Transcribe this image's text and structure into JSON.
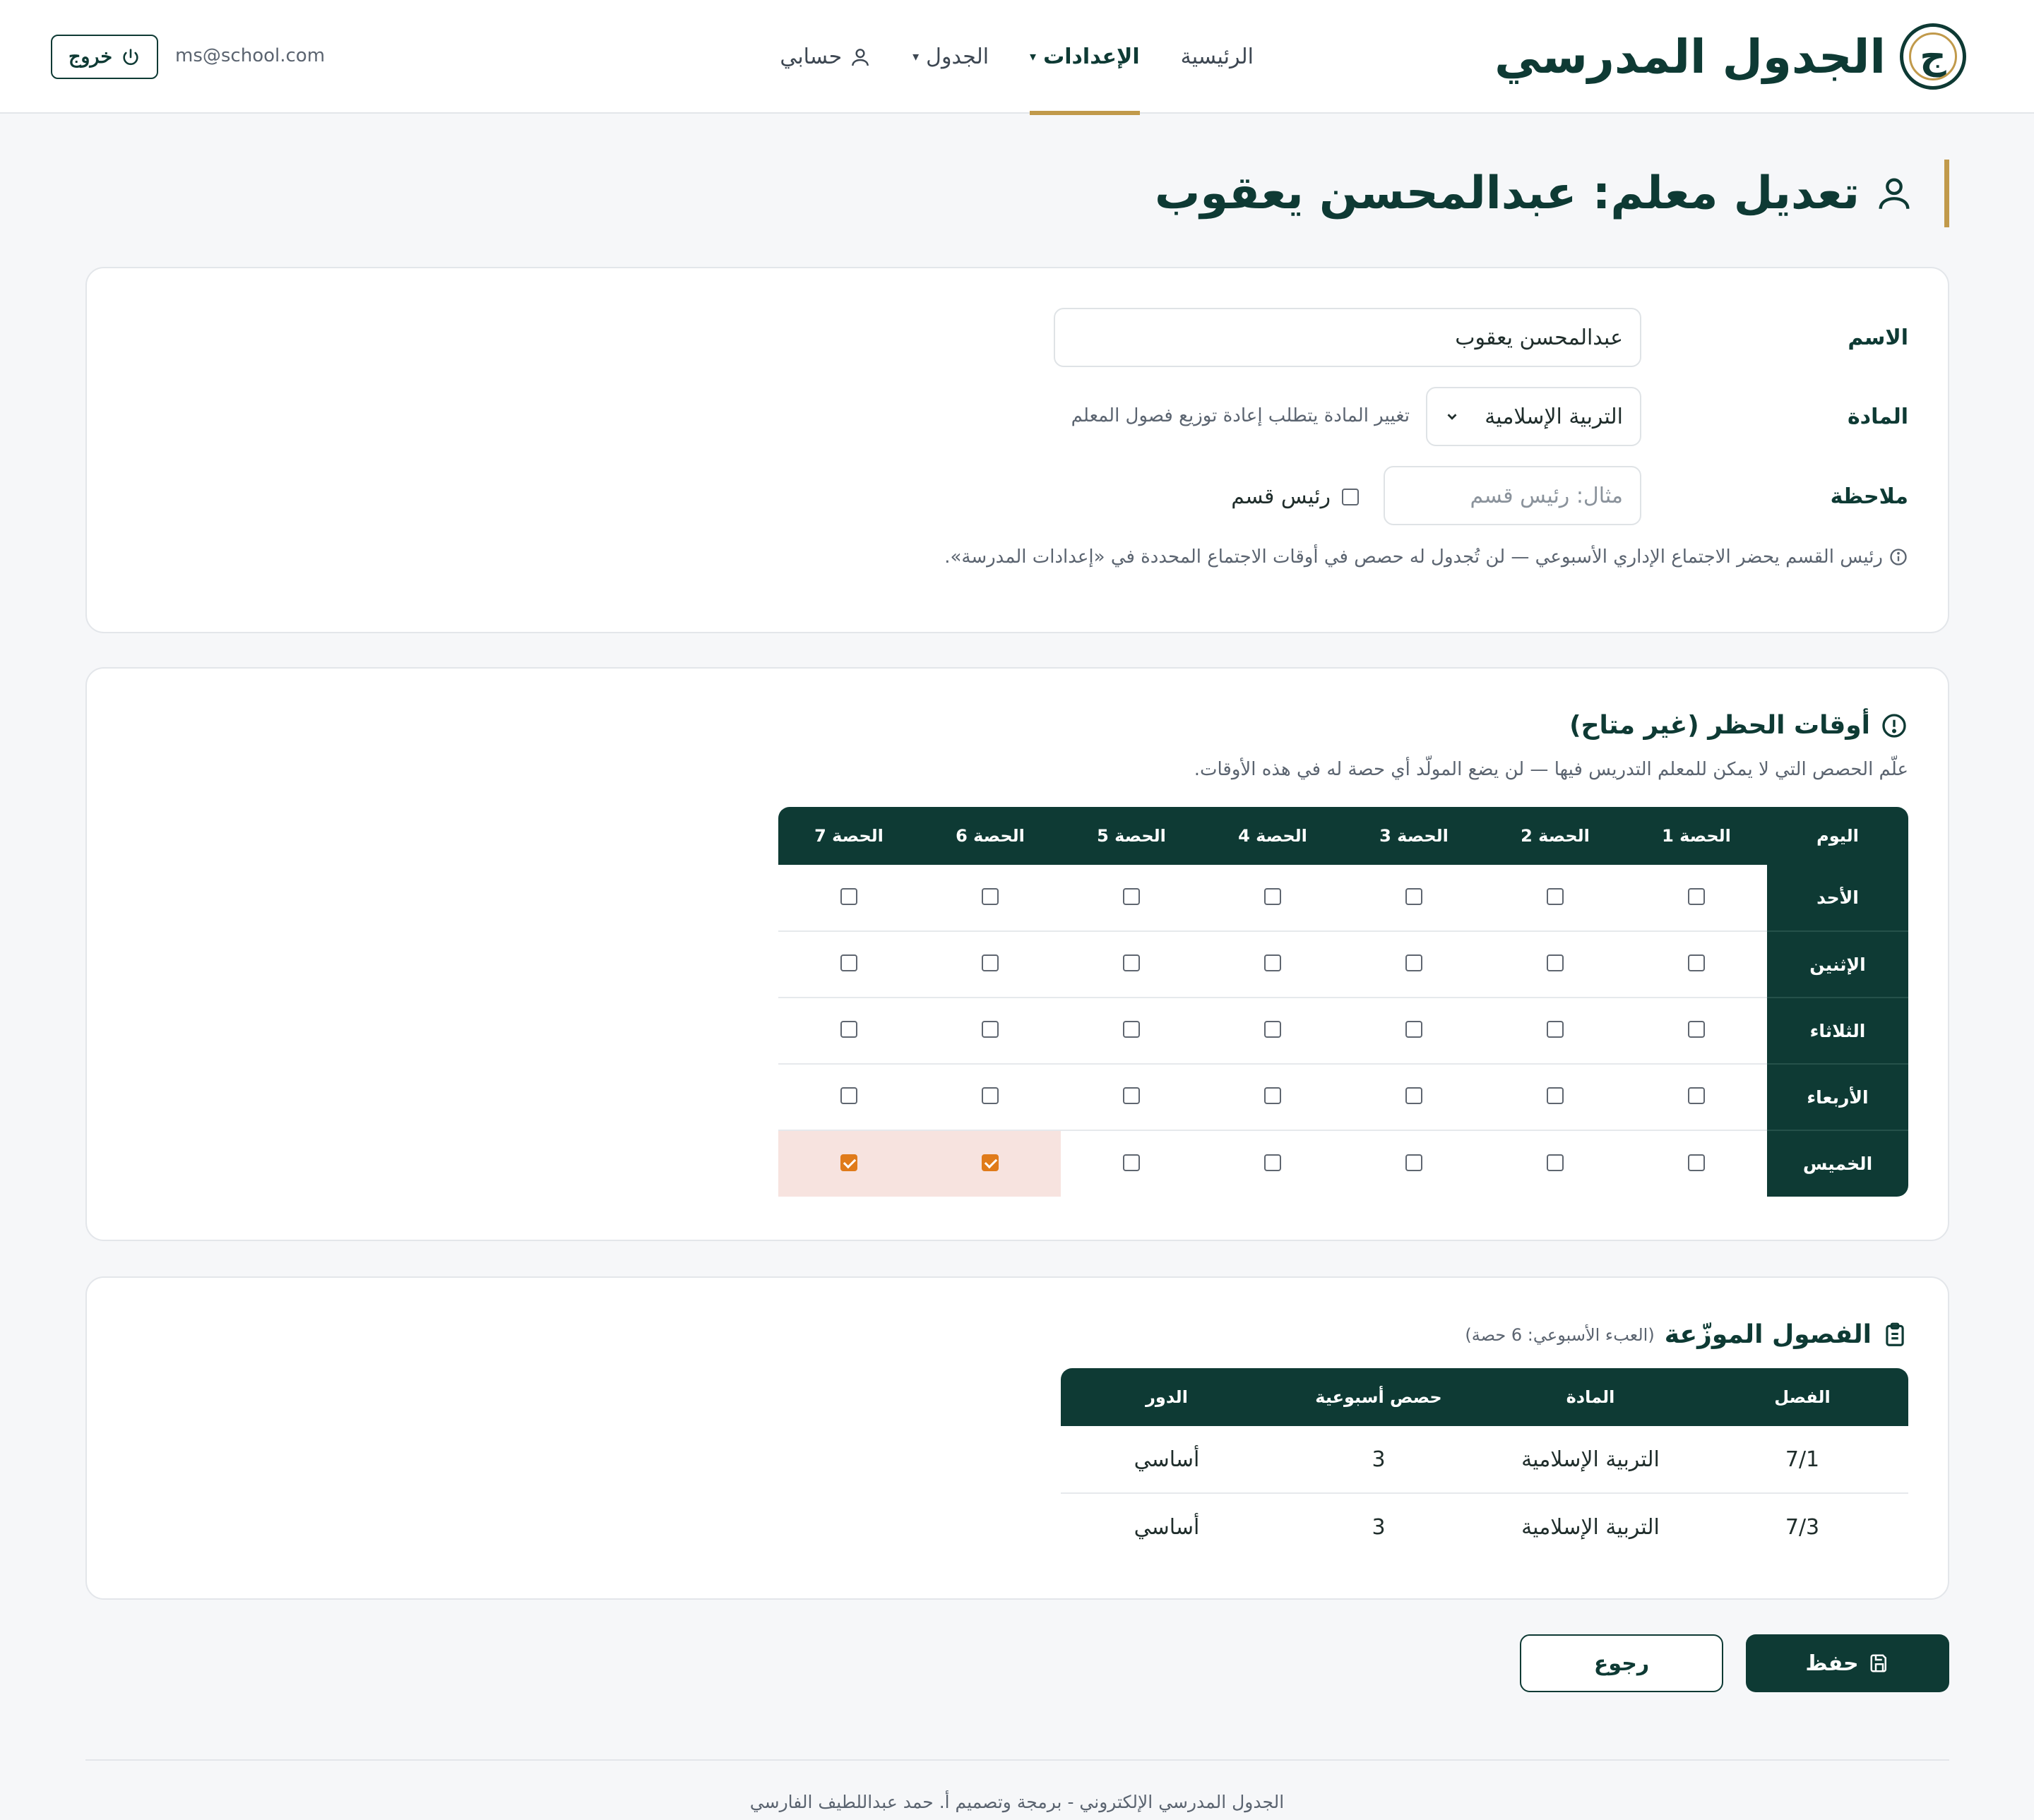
{
  "header": {
    "brand_title": "الجدول المدرسي",
    "brand_logo": "ج",
    "nav": {
      "home": "الرئيسية",
      "settings": "الإعدادات",
      "schedule": "الجدول",
      "account": "حسابي"
    },
    "email": "ms@school.com",
    "logout": "خروج"
  },
  "page": {
    "title": "تعديل معلم: عبدالمحسن يعقوب"
  },
  "form": {
    "name_label": "الاسم",
    "name_value": "عبدالمحسن يعقوب",
    "subject_label": "المادة",
    "subject_value": "التربية الإسلامية",
    "subject_hint": "تغيير المادة يتطلب إعادة توزيع فصول المعلم",
    "note_label": "ملاحظة",
    "note_placeholder": "مثال: رئيس قسم",
    "head_checkbox_label": "رئيس قسم",
    "head_checked": false,
    "info_text": "رئيس القسم يحضر الاجتماع الإداري الأسبوعي — لن تُجدول له حصص في أوقات الاجتماع المحددة في «إعدادات المدرسة»."
  },
  "blocked": {
    "title": "أوقات الحظر (غير متاح)",
    "description": "علّم الحصص التي لا يمكن للمعلم التدريس فيها — لن يضع المولّد أي حصة له في هذه الأوقات.",
    "day_header": "اليوم",
    "periods": [
      "الحصة 1",
      "الحصة 2",
      "الحصة 3",
      "الحصة 4",
      "الحصة 5",
      "الحصة 6",
      "الحصة 7"
    ],
    "rows": [
      {
        "day": "الأحد",
        "checked": [
          false,
          false,
          false,
          false,
          false,
          false,
          false
        ]
      },
      {
        "day": "الإثنين",
        "checked": [
          false,
          false,
          false,
          false,
          false,
          false,
          false
        ]
      },
      {
        "day": "الثلاثاء",
        "checked": [
          false,
          false,
          false,
          false,
          false,
          false,
          false
        ]
      },
      {
        "day": "الأربعاء",
        "checked": [
          false,
          false,
          false,
          false,
          false,
          false,
          false
        ]
      },
      {
        "day": "الخميس",
        "checked": [
          false,
          false,
          false,
          false,
          false,
          true,
          true
        ]
      }
    ],
    "blocked_highlight_color": "#f7e3df",
    "checked_color": "#e07b1a"
  },
  "classes": {
    "title": "الفصول الموزّعة",
    "load_note": "(العبء الأسبوعي: 6 حصة)",
    "headers": [
      "الفصل",
      "المادة",
      "حصص أسبوعية",
      "الدور"
    ],
    "rows": [
      [
        "7/1",
        "التربية الإسلامية",
        "3",
        "أساسي"
      ],
      [
        "7/3",
        "التربية الإسلامية",
        "3",
        "أساسي"
      ]
    ]
  },
  "actions": {
    "save": "حفظ",
    "back": "رجوع"
  },
  "footer": {
    "text": "الجدول المدرسي الإلكتروني - برمجة وتصميم أ. حمد عبداللطيف الفارسي"
  },
  "colors": {
    "primary": "#0e3a34",
    "accent": "#c19a4b",
    "background": "#f6f7f9"
  },
  "icons": [
    "power-icon",
    "user-icon",
    "caret-down-icon",
    "info-icon",
    "alert-circle-icon",
    "clipboard-icon",
    "save-icon",
    "chevron-down-icon"
  ]
}
